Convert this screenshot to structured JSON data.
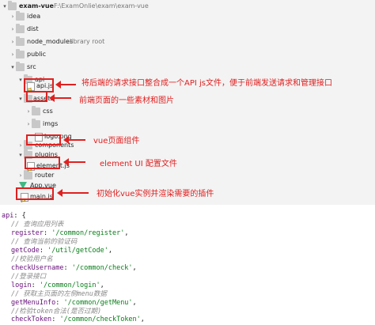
{
  "tree": {
    "root": {
      "name": "exam-vue",
      "path": "F:\\ExamOnlie\\exam\\exam-vue"
    },
    "items": [
      {
        "label": "idea"
      },
      {
        "label": "dist"
      },
      {
        "label": "node_modules",
        "suffix": "library root"
      },
      {
        "label": "public"
      },
      {
        "label": "src"
      },
      {
        "label": "api"
      },
      {
        "label": "api.js"
      },
      {
        "label": "assets"
      },
      {
        "label": "css"
      },
      {
        "label": "imgs"
      },
      {
        "label": "logo.png"
      },
      {
        "label": "components"
      },
      {
        "label": "plugins"
      },
      {
        "label": "element.js"
      },
      {
        "label": "router"
      },
      {
        "label": "App.vue"
      },
      {
        "label": "main.js"
      }
    ]
  },
  "annotations": [
    "将后端的请求接口整合成一个API js文件，便于前端发送请求和管理接口",
    "前端页面的一些素材和图片",
    "vue页面组件",
    "element UI 配置文件",
    "初始化vue实例并渲染需要的插件"
  ],
  "code": {
    "lines": [
      {
        "key": "api",
        "after": ": {"
      },
      {
        "comment": "// 查询应用列表"
      },
      {
        "key": "register",
        "value": "'/common/register'"
      },
      {
        "comment": "// 查询当前的验证码"
      },
      {
        "key": "getCode",
        "value": "'/util/getCode'"
      },
      {
        "comment": "//校验用户名"
      },
      {
        "key": "checkUsername",
        "value": "'/common/check'"
      },
      {
        "comment": "//登录接口"
      },
      {
        "key": "login",
        "value": "'/common/login'"
      },
      {
        "comment": "// 获取主页面的左侧menu数据"
      },
      {
        "key": "getMenuInfo",
        "value": "'/common/getMenu'"
      },
      {
        "comment": "//检验token合法(是否过期)"
      },
      {
        "key": "checkToken",
        "value": "'/common/checkToken'"
      }
    ]
  },
  "colors": {
    "accent": "#e02020",
    "folder_blue": "#7aa7d6",
    "vue_green": "#41b883"
  }
}
